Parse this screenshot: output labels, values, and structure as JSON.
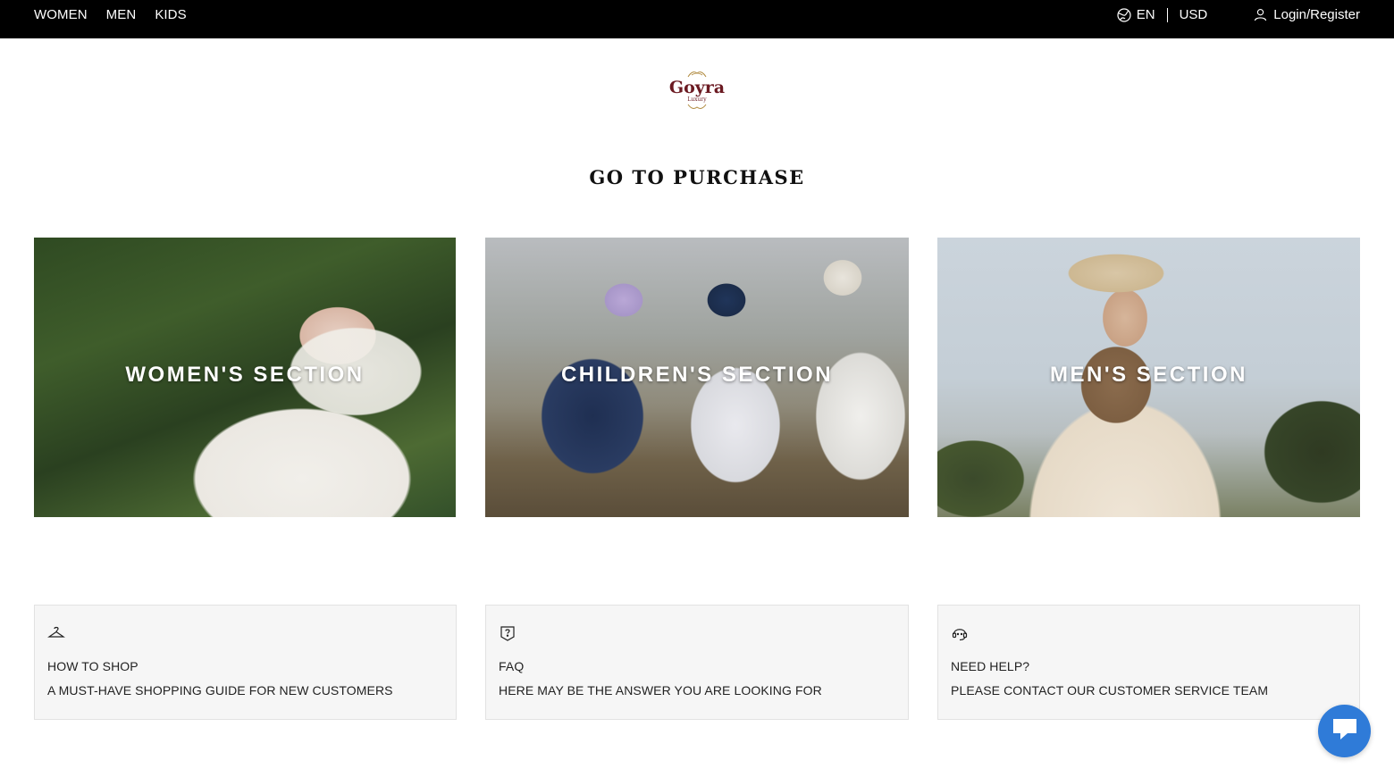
{
  "topbar": {
    "nav": [
      "WOMEN",
      "MEN",
      "KIDS"
    ],
    "language": "EN",
    "currency": "USD",
    "login": "Login/Register"
  },
  "logo": {
    "name": "Goyra",
    "tagline": "Luxury",
    "color": "#6b1a22"
  },
  "page_title": "GO TO PURCHASE",
  "sections": [
    {
      "label": "WOMEN'S SECTION"
    },
    {
      "label": "CHILDREN'S SECTION"
    },
    {
      "label": "MEN'S SECTION"
    }
  ],
  "info_cards": [
    {
      "icon": "hanger-icon",
      "title": "HOW TO SHOP",
      "description": "A MUST-HAVE SHOPPING GUIDE FOR NEW CUSTOMERS"
    },
    {
      "icon": "question-icon",
      "title": "FAQ",
      "description": "HERE MAY BE THE ANSWER YOU ARE LOOKING FOR"
    },
    {
      "icon": "support-agent-icon",
      "title": "NEED HELP?",
      "description": "PLEASE CONTACT OUR CUSTOMER SERVICE TEAM"
    }
  ],
  "chat": {
    "icon": "chat-icon",
    "color": "#2f7bd8"
  }
}
